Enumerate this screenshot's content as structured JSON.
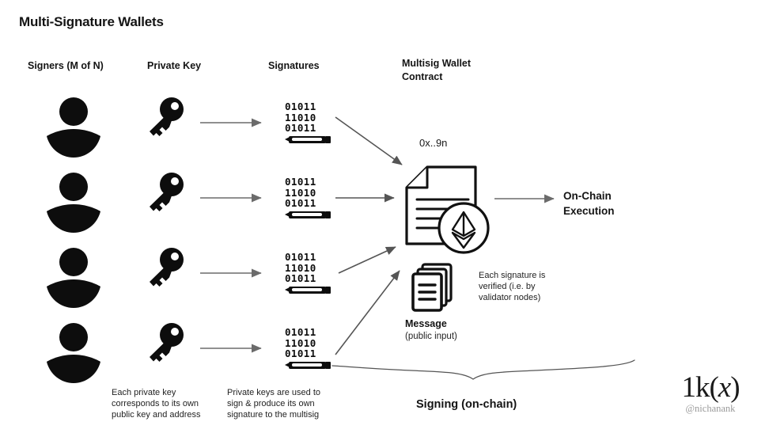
{
  "title": "Multi-Signature Wallets",
  "headers": [
    {
      "label": "Signers (M of N)",
      "name": "header-signers"
    },
    {
      "label": "Private Key",
      "name": "header-private-key"
    },
    {
      "label": "Signatures",
      "name": "header-signatures"
    },
    {
      "label": "Multisig Wallet\nContract",
      "name": "header-multisig-wallet-contract"
    }
  ],
  "signature_rows": [
    {
      "lines": [
        "01011",
        "11010",
        "01011"
      ]
    },
    {
      "lines": [
        "01011",
        "11010",
        "01011"
      ]
    },
    {
      "lines": [
        "01011",
        "11010",
        "01011"
      ]
    },
    {
      "lines": [
        "01011",
        "11010",
        "01011"
      ]
    }
  ],
  "contract": {
    "address": "0x..9n",
    "icon": "contract-document-ethereum-icon"
  },
  "execution": {
    "label": "On-Chain\nExecution"
  },
  "message": {
    "title": "Message",
    "subtitle": "(public input)",
    "note": "Each signature is\nverified (i.e. by\nvalidator nodes)"
  },
  "captions": {
    "private_key": "Each private key\ncorresponds to its own\npublic key and address",
    "signing": "Private keys are used to\nsign & produce its own\nsignature to the multisig"
  },
  "brace": {
    "label": "Signing (on-chain)"
  },
  "watermark": {
    "mark_prefix": "1k(",
    "mark_italic": "x",
    "mark_suffix": ")",
    "handle": "@nichanank"
  },
  "colors": {
    "ink": "#141414",
    "arrow": "#6b6b6b",
    "muted": "#9a9a9a"
  }
}
